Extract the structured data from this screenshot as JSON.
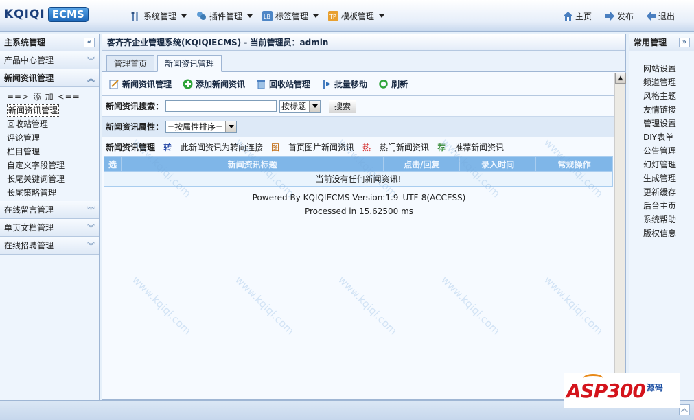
{
  "logo": {
    "text": "KQIQI",
    "badge": "ECMS"
  },
  "topmenu": [
    {
      "label": "系统管理",
      "icon": "wrench-icon"
    },
    {
      "label": "插件管理",
      "icon": "plugin-icon"
    },
    {
      "label": "标签管理",
      "icon": "tag-icon"
    },
    {
      "label": "模板管理",
      "icon": "template-icon"
    }
  ],
  "toplinks": [
    {
      "label": "主页",
      "icon": "home-icon"
    },
    {
      "label": "发布",
      "icon": "publish-icon"
    },
    {
      "label": "退出",
      "icon": "logout-icon"
    }
  ],
  "left": {
    "title": "主系统管理",
    "sections": [
      {
        "label": "产品中心管理"
      },
      {
        "label": "新闻资讯管理"
      },
      {
        "label": "在线留言管理"
      },
      {
        "label": "单页文档管理"
      },
      {
        "label": "在线招聘管理"
      }
    ],
    "subitems": {
      "add": "==> 添 加 <==",
      "items": [
        "新闻资讯管理",
        "回收站管理",
        "评论管理",
        "栏目管理",
        "自定义字段管理",
        "长尾关键词管理",
        "长尾策略管理"
      ]
    }
  },
  "main": {
    "breadcrumb": "客齐齐企业管理系统(KQIQIECMS) - 当前管理员：admin",
    "tabs": [
      "管理首页",
      "新闻资讯管理"
    ],
    "toolbar": [
      "新闻资讯管理",
      "添加新闻资讯",
      "回收站管理",
      "批量移动",
      "刷新"
    ],
    "search": {
      "label": "新闻资讯搜索：",
      "value": "",
      "select": "按标题",
      "button": "搜索"
    },
    "attr": {
      "label": "新闻资讯属性：",
      "select": "=按属性排序="
    },
    "legend": {
      "title": "新闻资讯管理",
      "items": [
        {
          "mark": "转",
          "text": "---此新闻资讯为转向连接",
          "color": "#1b3fa0"
        },
        {
          "mark": "图",
          "text": "---首页图片新闻资讯",
          "color": "#c06a10"
        },
        {
          "mark": "热",
          "text": "---热门新闻资讯",
          "color": "#d01818"
        },
        {
          "mark": "荐",
          "text": "---推荐新闻资讯",
          "color": "#1a7a1a"
        }
      ]
    },
    "table": {
      "headers": [
        "选",
        "新闻资讯标题",
        "点击/回复",
        "录入时间",
        "常规操作"
      ],
      "empty": "当前没有任何新闻资讯!"
    },
    "footer": {
      "powered": "Powered By KQIQIECMS Version:1.9_UTF-8(ACCESS)",
      "processed": "Processed in 15.62500 ms"
    },
    "watermark": "www.kqiqi.com"
  },
  "right": {
    "title": "常用管理",
    "links": [
      "网站设置",
      "频道管理",
      "风格主题",
      "友情链接",
      "管理设置",
      "DIY表单",
      "公告管理",
      "幻灯管理",
      "生成管理",
      "更新缓存",
      "后台主页",
      "系统帮助",
      "版权信息"
    ]
  },
  "brand_badge": {
    "text": "ASP300",
    "sub": "源码"
  }
}
